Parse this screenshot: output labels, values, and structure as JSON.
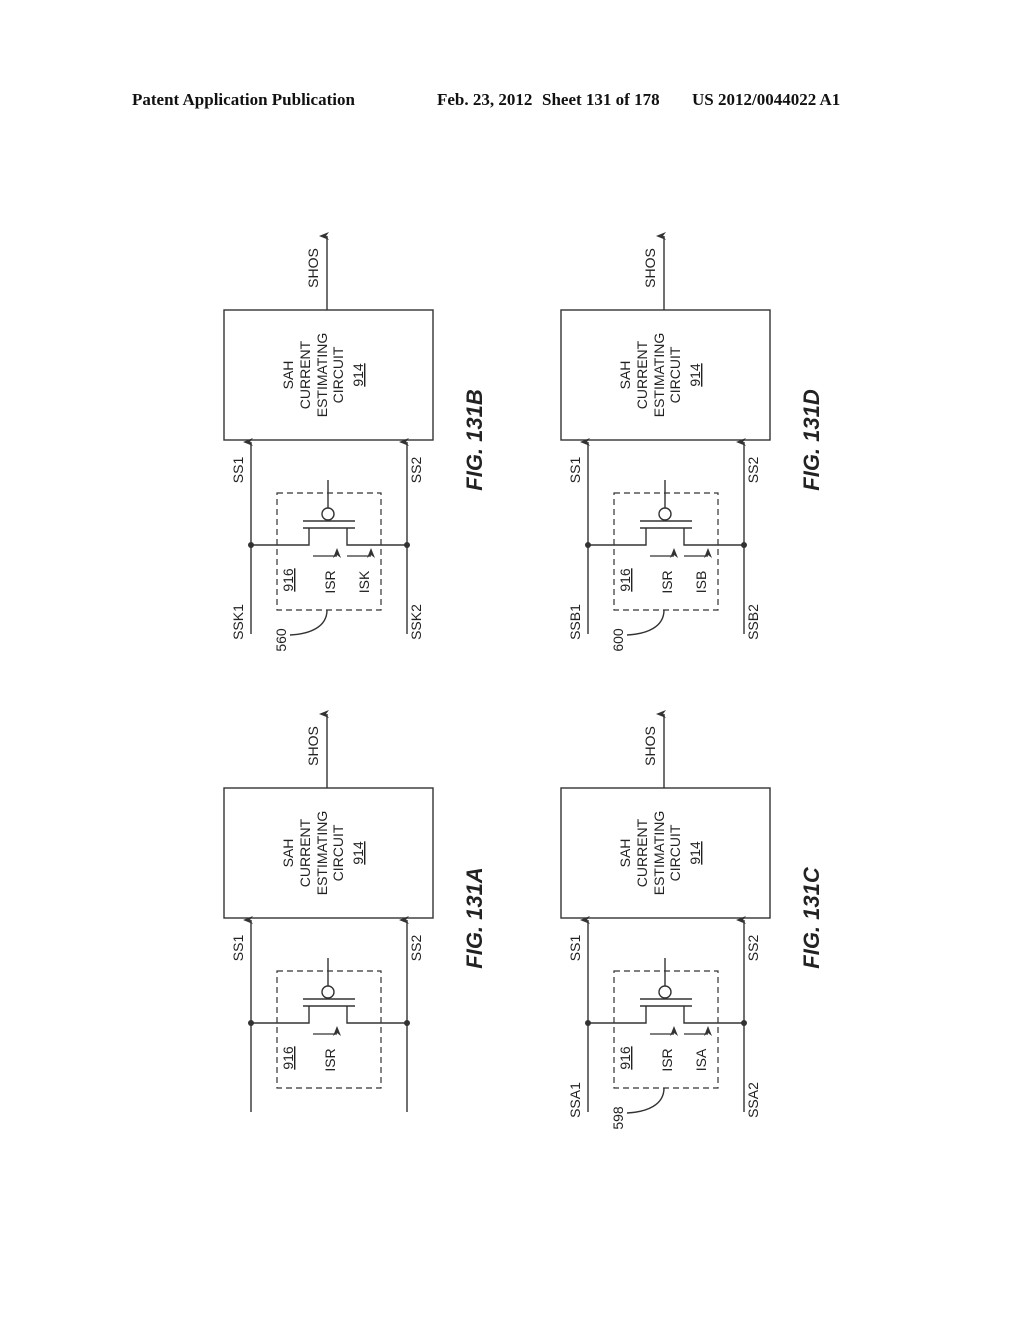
{
  "header": {
    "publication": "Patent Application Publication",
    "date": "Feb. 23, 2012",
    "sheet": "Sheet 131 of 178",
    "number": "US 2012/0044022 A1"
  },
  "figures": [
    {
      "id": "131A",
      "fig_label": "FIG. 131A",
      "block": {
        "lines": [
          "SAH",
          "CURRENT",
          "ESTIMATING",
          "CIRCUIT"
        ],
        "ref": "914"
      },
      "output": "SHOS",
      "input_top": "SS1",
      "input_bottom": "SS2",
      "source_top": "",
      "source_bottom": "",
      "switch_ref": "916",
      "currents": [
        "ISR"
      ],
      "callout": ""
    },
    {
      "id": "131B",
      "fig_label": "FIG. 131B",
      "block": {
        "lines": [
          "SAH",
          "CURRENT",
          "ESTIMATING",
          "CIRCUIT"
        ],
        "ref": "914"
      },
      "output": "SHOS",
      "input_top": "SS1",
      "input_bottom": "SS2",
      "source_top": "SSK1",
      "source_bottom": "SSK2",
      "switch_ref": "916",
      "currents": [
        "ISR",
        "ISK"
      ],
      "callout": "560"
    },
    {
      "id": "131C",
      "fig_label": "FIG. 131C",
      "block": {
        "lines": [
          "SAH",
          "CURRENT",
          "ESTIMATING",
          "CIRCUIT"
        ],
        "ref": "914"
      },
      "output": "SHOS",
      "input_top": "SS1",
      "input_bottom": "SS2",
      "source_top": "SSA1",
      "source_bottom": "SSA2",
      "switch_ref": "916",
      "currents": [
        "ISR",
        "ISA"
      ],
      "callout": "598"
    },
    {
      "id": "131D",
      "fig_label": "FIG. 131D",
      "block": {
        "lines": [
          "SAH",
          "CURRENT",
          "ESTIMATING",
          "CIRCUIT"
        ],
        "ref": "914"
      },
      "output": "SHOS",
      "input_top": "SS1",
      "input_bottom": "SS2",
      "source_top": "SSB1",
      "source_bottom": "SSB2",
      "switch_ref": "916",
      "currents": [
        "ISR",
        "ISB"
      ],
      "callout": "600"
    }
  ]
}
